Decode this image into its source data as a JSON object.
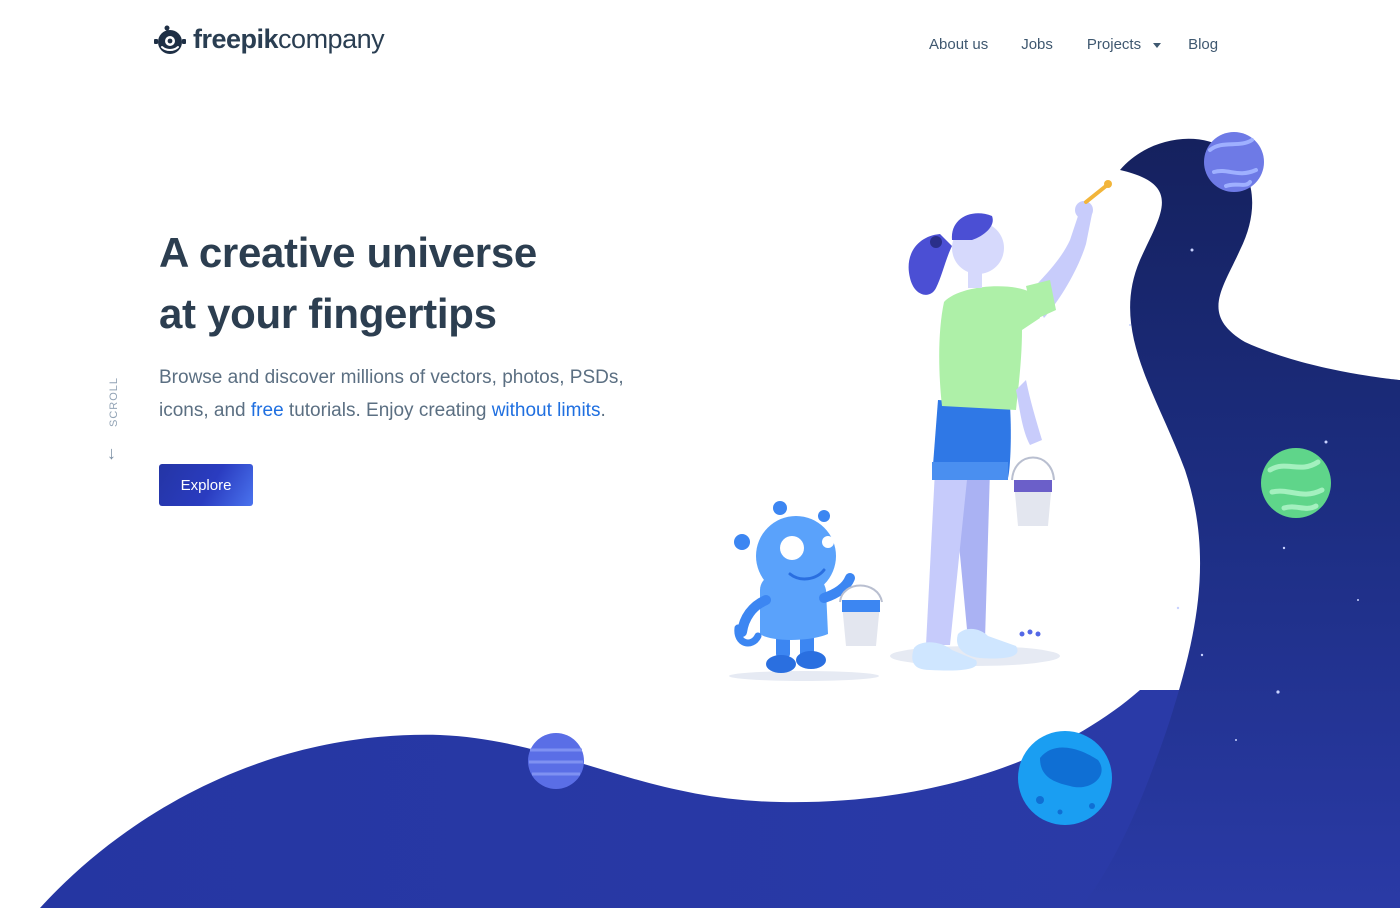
{
  "header": {
    "logo": {
      "brand_bold": "freepik",
      "brand_light": "company",
      "icon": "freepik-robot-logo-icon"
    },
    "nav": {
      "about": "About us",
      "jobs": "Jobs",
      "projects": "Projects",
      "projects_icon": "caret-down-icon",
      "blog": "Blog"
    }
  },
  "hero": {
    "title_line1": "A creative universe",
    "title_line2": "at your fingertips",
    "subtitle": {
      "line1": "Browse and discover millions of vectors, photos, PSDs,",
      "line2_part1": "icons, and ",
      "link_free": "free",
      "line2_part2": " tutorials. Enjoy creating ",
      "link_without_limits": "without limits",
      "line2_part3": "."
    },
    "button_label": "Explore"
  },
  "scroll": {
    "label": "SCROLL",
    "icon": "arrow-down-icon"
  },
  "colors": {
    "text_dark": "#2c3e50",
    "text_body": "#5b6f82",
    "link": "#1f6fe0",
    "space_dark": "#15256a",
    "space_light": "#2a3aa6",
    "button_start": "#2435a5",
    "button_end": "#4a73ee"
  },
  "illustration": {
    "characters": [
      "girl-painting",
      "robot-with-bucket"
    ],
    "planets": [
      "planet-purple-top",
      "planet-green",
      "planet-purple-bottom",
      "planet-blue"
    ]
  }
}
